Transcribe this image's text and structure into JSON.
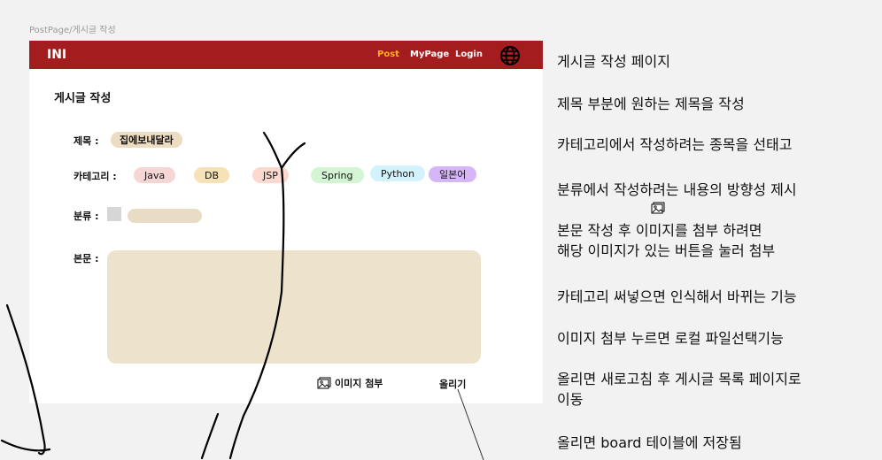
{
  "frame_label": "PostPage/게시글 작성",
  "header": {
    "brand": "INI",
    "nav": [
      {
        "label": "Post",
        "active": true
      },
      {
        "label": "MyPage",
        "active": false
      },
      {
        "label": "Login",
        "active": false
      }
    ],
    "globe_icon": "globe-icon"
  },
  "page_title": "게시글 작성",
  "form": {
    "title_label": "제목 :",
    "title_value": "집에보내달라",
    "category_label": "카테고리 :",
    "categories": [
      {
        "label": "Java",
        "color": "#f6d5d5"
      },
      {
        "label": "DB",
        "color": "#f7e2b8"
      },
      {
        "label": "JSP",
        "color": "#fbd9cf"
      },
      {
        "label": "Spring",
        "color": "#d3f5d3"
      },
      {
        "label": "Python",
        "color": "#d4f2fb"
      },
      {
        "label": "일본어",
        "color": "#d7b6f7"
      }
    ],
    "classification_label": "분류 :",
    "body_label": "본문 :",
    "attach_label": "이미지 첨부",
    "upload_label": "올리기"
  },
  "notes": [
    "게시글 작성 페이지",
    "제목 부분에 원하는 제목을 작성",
    "카테고리에서 작성하려는 종목을 선태고",
    "분류에서 작성하려는 내용의 방향성 제시",
    "본문 작성 후      이미지를 첨부 하려면",
    "해당 이미지가 있는 버튼을 눌러 첨부",
    "카테고리 써넣으면 인식해서 바뀌는 기능",
    "이미지 첨부 누르면 로컬 파일선택기능",
    "올리면 새로고침 후 게시글 목록 페이지로",
    "이동",
    "올리면 board 테이블에 저장됨"
  ],
  "colors": {
    "header_bg": "#a31d1f",
    "active_nav": "#ffb020",
    "title_pill": "#ecdcc2",
    "body_area": "#ede2cc"
  }
}
